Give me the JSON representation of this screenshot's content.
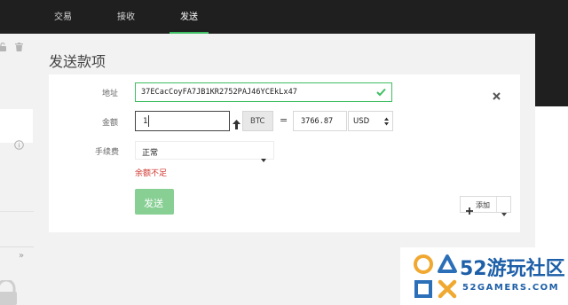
{
  "nav": {
    "tabs": [
      {
        "label": "交易"
      },
      {
        "label": "接收"
      },
      {
        "label": "发送"
      }
    ]
  },
  "page": {
    "title": "发送款项"
  },
  "form": {
    "address": {
      "label": "地址",
      "value": "37ECacCoyFA7JB1KR2752PAJ46YCEkLx47"
    },
    "amount": {
      "label": "金额",
      "value": "1",
      "btc_unit": "BTC",
      "equals": "=",
      "fiat_value": "3766.87",
      "fiat_currency": "USD"
    },
    "fee": {
      "label": "手续费",
      "value": "正常",
      "error": "余额不足"
    },
    "send_button": "发送",
    "add_button": "添加"
  },
  "sidebar": {
    "collapse": "»"
  },
  "watermark": {
    "big": "52游玩社区",
    "small": "52GAMERS.COM"
  },
  "colors": {
    "accent": "#3fbf63",
    "error": "#d0342c",
    "topbar": "#1f1f1f"
  }
}
